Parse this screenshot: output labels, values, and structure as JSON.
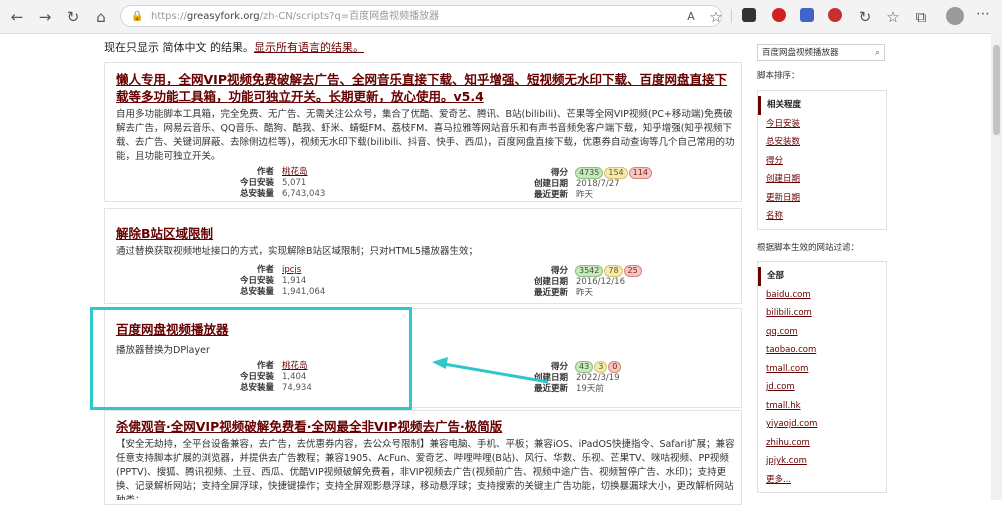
{
  "browser": {
    "url_prefix": "https://",
    "url_host": "greasyfork.org",
    "url_path": "/zh-CN/scripts?q=百度网盘视频播放器"
  },
  "colors": {
    "accent": "#670000",
    "highlight": "#2fc7c9"
  },
  "locale_note": {
    "text": "现在只显示 简体中文 的结果。",
    "link": "显示所有语言的结果。"
  },
  "meta_labels": {
    "author": "作者",
    "daily": "今日安装",
    "total": "总安装量",
    "score": "得分",
    "created": "创建日期",
    "updated": "最近更新"
  },
  "scripts": [
    {
      "title": "懒人专用，全网VIP视频免费破解去广告、全网音乐直接下载、知乎增强、短视频无水印下载、百度网盘直接下载等多功能工具箱，功能可独立开关。长期更新，放心使用。v5.4",
      "description": "自用多功能脚本工具箱，完全免费、无广告、无需关注公众号，集合了优酷、爱奇艺、腾讯、B站(bilibili)、芒果等全网VIP视频(PC+移动端)免费破解去广告，网易云音乐、QQ音乐、酷狗、酷我、虾米、蜻蜓FM、荔枝FM、喜马拉雅等网站音乐和有声书音频免客户端下载，知乎增强(知乎视频下载、去广告、关键词屏蔽、去除侧边栏等)，视频无水印下载(bilibili、抖音、快手、西瓜)，百度网盘直接下载，优惠券自动查询等几个自己常用的功能，且功能可独立开关。",
      "author": "桃花岛",
      "daily": "5,071",
      "total": "6,743,043",
      "score_good": "4735",
      "score_ok": "154",
      "score_bad": "114",
      "created": "2018/7/27",
      "updated": "昨天"
    },
    {
      "title": "解除B站区域限制",
      "description": "通过替换获取视频地址接口的方式，实现解除B站区域限制；只对HTML5播放器生效；",
      "author": "ipcjs",
      "daily": "1,914",
      "total": "1,941,064",
      "score_good": "3542",
      "score_ok": "78",
      "score_bad": "25",
      "created": "2016/12/16",
      "updated": "昨天"
    },
    {
      "title": "百度网盘视频播放器",
      "description": "播放器替换为DPlayer",
      "author": "桃花岛",
      "daily": "1,404",
      "total": "74,934",
      "score_good": "43",
      "score_ok": "3",
      "score_bad": "0",
      "created": "2022/3/19",
      "updated": "19天前"
    },
    {
      "title": "杀佛观音·全网VIP视频破解免费看·全网最全非VIP视频去广告·极简版",
      "description": "【安全无劫持，全平台设备兼容，去广告，去优惠券内容，去公众号限制】兼容电脑、手机、平板；兼容iOS、iPadOS快捷指令、Safari扩展；兼容任意支持脚本扩展的浏览器，并提供去广告教程；兼容1905、AcFun、爱奇艺、哔哩哔哩(B站)、风行、华数、乐视、芒果TV、咪咕视频、PP视频(PPTV)、搜狐、腾讯视频、土豆、西瓜、优酷VIP视频破解免费看，非VIP视频去广告(视频前广告、视频中途广告、视频暂停广告、水印)；支持更换、记录解析网站；支持全屏浮球，快捷键操作；支持全屏观影悬浮球，移动悬浮球；支持搜索的关键主广告功能，切换暴漏球大小，更改解析网站种类；"
    }
  ],
  "sidebar": {
    "search_value": "百度网盘视频播放器",
    "sort_label": "脚本排序：",
    "sort_items": [
      "相关程度",
      "今日安装",
      "总安装数",
      "得分",
      "创建日期",
      "更新日期",
      "名称"
    ],
    "sites_label": "根据脚本生效的网站过滤：",
    "site_items": [
      "全部",
      "baidu.com",
      "bilibili.com",
      "qq.com",
      "taobao.com",
      "tmall.com",
      "jd.com",
      "tmall.hk",
      "yiyaojd.com",
      "zhihu.com",
      "jpjyk.com",
      "更多..."
    ]
  }
}
